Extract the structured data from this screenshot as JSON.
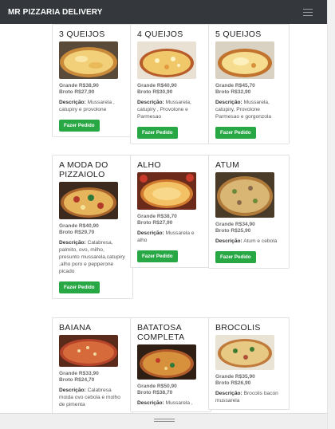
{
  "navbar": {
    "brand": "MR PIZZARIA DELIVERY"
  },
  "common": {
    "desc_label": "Descrição:",
    "order_button": "Fazer Pedido"
  },
  "pizzas": [
    {
      "name": "3 QUEIJOS",
      "grande": "Grande R$38,90",
      "broto": "Broto R$27,90",
      "desc": "Mussarela , catupiry e provolone"
    },
    {
      "name": "4 QUEIJOS",
      "grande": "Grande R$40,90",
      "broto": "Broto R$30,90",
      "desc": "Mussarela, catupiry , Provolone e Parmesao"
    },
    {
      "name": "5 QUEIJOS",
      "grande": "Grande R$45,70",
      "broto": "Broto R$32,90",
      "desc": "Mussarela, catupiry, Provolone Parmesao e gorgonzola"
    },
    {
      "name": "A MODA DO PIZZAIOLO",
      "grande": "Grande R$40,90",
      "broto": "Broto R$29,70",
      "desc": "Calabresa, palmito, ovo, milho, presunto mussarela,catupiry ,alho poro e pepperone picado"
    },
    {
      "name": "ALHO",
      "grande": "Grande R$38,70",
      "broto": "Broto R$27,90",
      "desc": "Mussarela e alho"
    },
    {
      "name": "ATUM",
      "grande": "Grande R$34,90",
      "broto": "Broto R$25,90",
      "desc": "Atum e cebola"
    },
    {
      "name": "BAIANA",
      "grande": "Grande R$33,90",
      "broto": "Broto R$24,70",
      "desc": "Calabresa moida ovo cebola e molho de pimenta"
    },
    {
      "name": "BATATOSA COMPLETA",
      "grande": "Grande R$50,90",
      "broto": "Broto R$38,70",
      "desc": "Mussarela ,"
    },
    {
      "name": "BROCOLIS",
      "grande": "Grande R$35,90",
      "broto": "Broto R$26,90",
      "desc": "Brocolis bacon mussarela"
    }
  ]
}
